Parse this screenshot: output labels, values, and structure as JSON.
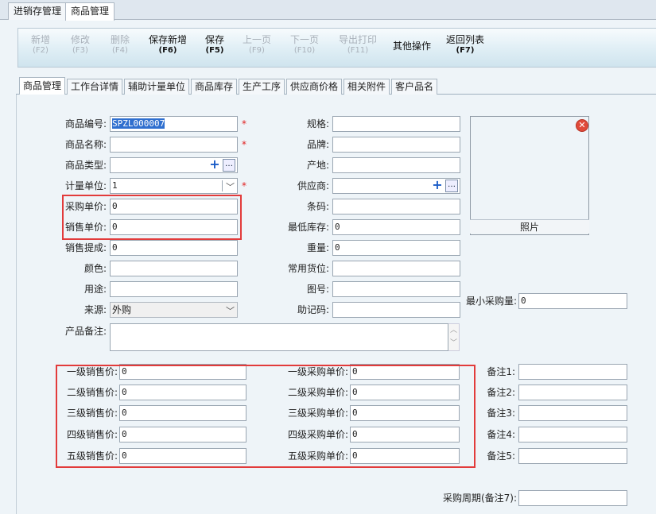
{
  "top_tabs": [
    {
      "label": "进销存管理",
      "active": false
    },
    {
      "label": "商品管理",
      "active": true
    }
  ],
  "toolbar": [
    {
      "label": "新增",
      "shortcut": "(F2)",
      "enabled": false
    },
    {
      "label": "修改",
      "shortcut": "(F3)",
      "enabled": false
    },
    {
      "label": "删除",
      "shortcut": "(F4)",
      "enabled": false
    },
    {
      "label": "保存新增",
      "shortcut": "(F6)",
      "enabled": true
    },
    {
      "label": "保存",
      "shortcut": "(F5)",
      "enabled": true
    },
    {
      "label": "上一页",
      "shortcut": "(F9)",
      "enabled": false
    },
    {
      "label": "下一页",
      "shortcut": "(F10)",
      "enabled": false
    },
    {
      "label": "导出打印",
      "shortcut": "(F11)",
      "enabled": false
    },
    {
      "label": "其他操作",
      "shortcut": "",
      "enabled": true
    },
    {
      "label": "返回列表",
      "shortcut": "(F7)",
      "enabled": true
    }
  ],
  "inner_tabs": [
    "商品管理",
    "工作台详情",
    "辅助计量单位",
    "商品库存",
    "生产工序",
    "供应商价格",
    "相关附件",
    "客户品名"
  ],
  "form": {
    "product_code": {
      "label": "商品编号:",
      "value": "SPZL000007"
    },
    "product_name": {
      "label": "商品名称:",
      "value": ""
    },
    "product_type": {
      "label": "商品类型:",
      "value": ""
    },
    "unit": {
      "label": "计量单位:",
      "value": "1"
    },
    "purchase_price": {
      "label": "采购单价:",
      "value": "0"
    },
    "sale_price": {
      "label": "销售单价:",
      "value": "0"
    },
    "sale_commission": {
      "label": "销售提成:",
      "value": "0"
    },
    "color": {
      "label": "颜色:",
      "value": ""
    },
    "usage": {
      "label": "用途:",
      "value": ""
    },
    "source": {
      "label": "来源:",
      "value": "外购"
    },
    "remark": {
      "label": "产品备注:",
      "value": ""
    },
    "spec": {
      "label": "规格:",
      "value": ""
    },
    "brand": {
      "label": "品牌:",
      "value": ""
    },
    "origin": {
      "label": "产地:",
      "value": ""
    },
    "supplier": {
      "label": "供应商:",
      "value": ""
    },
    "barcode": {
      "label": "条码:",
      "value": ""
    },
    "min_stock": {
      "label": "最低库存:",
      "value": "0"
    },
    "weight": {
      "label": "重量:",
      "value": "0"
    },
    "location": {
      "label": "常用货位:",
      "value": ""
    },
    "drawing_no": {
      "label": "图号:",
      "value": ""
    },
    "mnemonic": {
      "label": "助记码:",
      "value": ""
    },
    "min_purchase": {
      "label": "最小采购量:",
      "value": "0"
    },
    "photo_label": "照片",
    "purchase_cycle": {
      "label": "采购周期(备注7):",
      "value": ""
    }
  },
  "sale_levels": [
    {
      "label": "一级销售价:",
      "value": "0"
    },
    {
      "label": "二级销售价:",
      "value": "0"
    },
    {
      "label": "三级销售价:",
      "value": "0"
    },
    {
      "label": "四级销售价:",
      "value": "0"
    },
    {
      "label": "五级销售价:",
      "value": "0"
    }
  ],
  "purchase_levels": [
    {
      "label": "一级采购单价:",
      "value": "0"
    },
    {
      "label": "二级采购单价:",
      "value": "0"
    },
    {
      "label": "三级采购单价:",
      "value": "0"
    },
    {
      "label": "四级采购单价:",
      "value": "0"
    },
    {
      "label": "五级采购单价:",
      "value": "0"
    }
  ],
  "remarks": [
    {
      "label": "备注1:",
      "value": ""
    },
    {
      "label": "备注2:",
      "value": ""
    },
    {
      "label": "备注3:",
      "value": ""
    },
    {
      "label": "备注4:",
      "value": ""
    },
    {
      "label": "备注5:",
      "value": ""
    }
  ],
  "required_mark": "*",
  "highlight_color": "#e23b3b"
}
